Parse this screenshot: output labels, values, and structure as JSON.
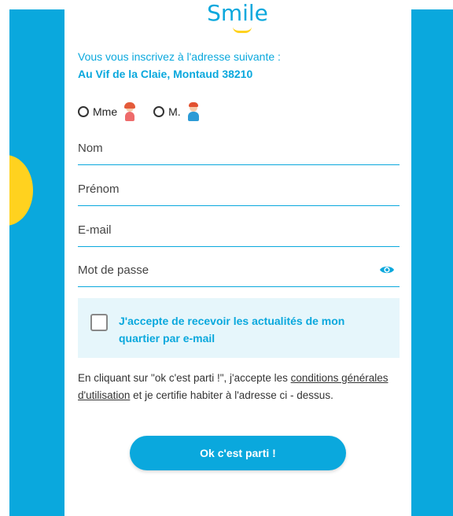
{
  "logo": {
    "text": "Smile"
  },
  "intro": {
    "text": "Vous vous inscrivez à l'adresse suivante :",
    "address": "Au Vif de la Claie, Montaud 38210"
  },
  "gender": {
    "options": [
      {
        "label": "Mme",
        "selected": false
      },
      {
        "label": "M.",
        "selected": false
      }
    ]
  },
  "form": {
    "nom_placeholder": "Nom",
    "prenom_placeholder": "Prénom",
    "email_placeholder": "E-mail",
    "password_placeholder": "Mot de passe"
  },
  "newsletter": {
    "checked": false,
    "label": "J'accepte de recevoir les actualités de mon quartier par e-mail"
  },
  "legal": {
    "prefix": "En cliquant sur \"ok c'est parti !\", j'accepte les ",
    "link": "conditions générales d'utilisation",
    "suffix": " et je certifie habiter à l'adresse ci - dessus."
  },
  "submit": {
    "label": "Ok c'est parti !"
  },
  "colors": {
    "accent": "#0aa8dd",
    "highlight": "#ffd21f",
    "newsletter_bg": "#e6f6fb"
  },
  "icons": [
    "avatar-female-icon",
    "avatar-male-icon",
    "eye-icon",
    "smile-logo"
  ]
}
